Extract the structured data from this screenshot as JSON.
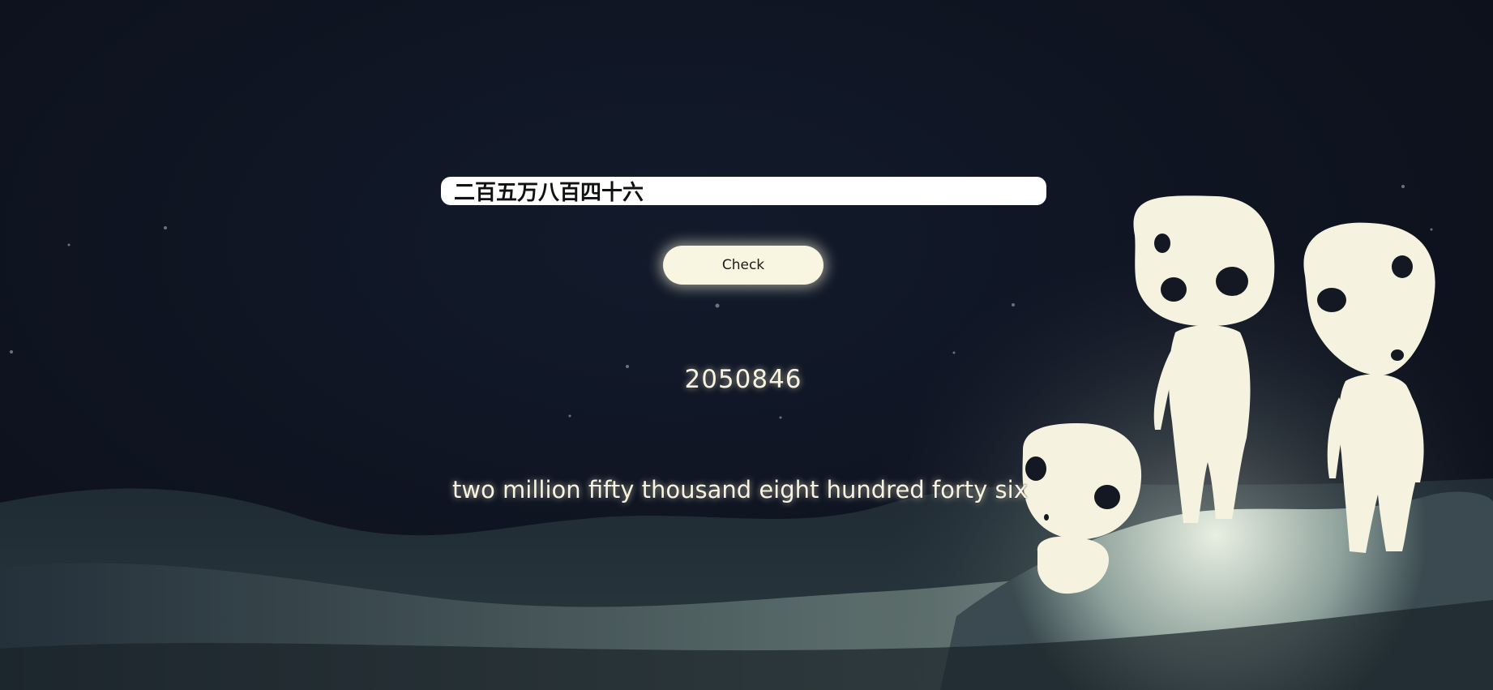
{
  "converter": {
    "input_value": "二百五万八百四十六",
    "check_label": "Check",
    "numeric_result": "2050846",
    "english_result": "two million fifty thousand eight hundred forty six"
  },
  "colors": {
    "background": "#0f1422",
    "button": "#f8f5e0",
    "figure": "#f5f3e0",
    "result_text": "#f6f3e2"
  }
}
